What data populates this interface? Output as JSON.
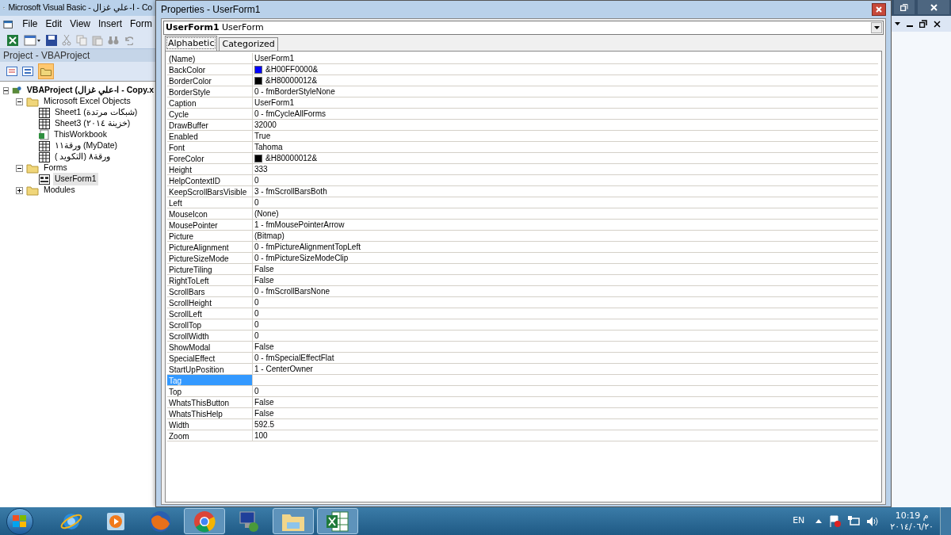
{
  "main_window": {
    "title": "Microsoft Visual Basic - ا-علي غزال - Co",
    "menu": [
      {
        "label": "File"
      },
      {
        "label": "Edit"
      },
      {
        "label": "View"
      },
      {
        "label": "Insert"
      },
      {
        "label": "Form"
      }
    ]
  },
  "project_pane": {
    "title": "Project - VBAProject",
    "tree": [
      {
        "label": "VBAProject (ا-علي غزال - Copy.x",
        "kind": "project",
        "expanded": true,
        "selected": false,
        "children": [
          {
            "label": "Microsoft Excel Objects",
            "kind": "folder",
            "expanded": true,
            "selected": false,
            "children": [
              {
                "label": "Sheet1 (شبكات مرتدة)",
                "kind": "sheet",
                "selected": false
              },
              {
                "label": "Sheet3 (خزينة ٢٠١٤)",
                "kind": "sheet",
                "selected": false
              },
              {
                "label": "ThisWorkbook",
                "kind": "workbook",
                "selected": false
              },
              {
                "label": "ورقة١١ (MyDate)",
                "kind": "sheet",
                "selected": false
              },
              {
                "label": "( ورقة٨ (التكويد",
                "kind": "sheet",
                "selected": false
              }
            ]
          },
          {
            "label": "Forms",
            "kind": "folder",
            "expanded": true,
            "selected": false,
            "children": [
              {
                "label": "UserForm1",
                "kind": "form",
                "selected": true
              }
            ]
          },
          {
            "label": "Modules",
            "kind": "folder",
            "expanded": false,
            "selected": false
          }
        ]
      }
    ]
  },
  "properties_window": {
    "title": "Properties - UserForm1",
    "object_name": "UserForm1",
    "object_type": "UserForm",
    "tabs": [
      {
        "label": "Alphabetic",
        "selected": true
      },
      {
        "label": "Categorized",
        "selected": false
      }
    ],
    "rows": [
      {
        "name": "(Name)",
        "value": "UserForm1",
        "selected": false
      },
      {
        "name": "BackColor",
        "value": "&H00FF0000&",
        "color": "#0000ff",
        "selected": false
      },
      {
        "name": "BorderColor",
        "value": "&H80000012&",
        "color": "#000000",
        "selected": false
      },
      {
        "name": "BorderStyle",
        "value": "0 - fmBorderStyleNone",
        "selected": false
      },
      {
        "name": "Caption",
        "value": "UserForm1",
        "selected": false
      },
      {
        "name": "Cycle",
        "value": "0 - fmCycleAllForms",
        "selected": false
      },
      {
        "name": "DrawBuffer",
        "value": "32000",
        "selected": false
      },
      {
        "name": "Enabled",
        "value": "True",
        "selected": false
      },
      {
        "name": "Font",
        "value": "Tahoma",
        "selected": false
      },
      {
        "name": "ForeColor",
        "value": "&H80000012&",
        "color": "#000000",
        "selected": false
      },
      {
        "name": "Height",
        "value": "333",
        "selected": false
      },
      {
        "name": "HelpContextID",
        "value": "0",
        "selected": false
      },
      {
        "name": "KeepScrollBarsVisible",
        "value": "3 - fmScrollBarsBoth",
        "selected": false
      },
      {
        "name": "Left",
        "value": "0",
        "selected": false
      },
      {
        "name": "MouseIcon",
        "value": "(None)",
        "selected": false
      },
      {
        "name": "MousePointer",
        "value": "1 - fmMousePointerArrow",
        "selected": false
      },
      {
        "name": "Picture",
        "value": "(Bitmap)",
        "selected": false
      },
      {
        "name": "PictureAlignment",
        "value": "0 - fmPictureAlignmentTopLeft",
        "selected": false
      },
      {
        "name": "PictureSizeMode",
        "value": "0 - fmPictureSizeModeClip",
        "selected": false
      },
      {
        "name": "PictureTiling",
        "value": "False",
        "selected": false
      },
      {
        "name": "RightToLeft",
        "value": "False",
        "selected": false
      },
      {
        "name": "ScrollBars",
        "value": "0 - fmScrollBarsNone",
        "selected": false
      },
      {
        "name": "ScrollHeight",
        "value": "0",
        "selected": false
      },
      {
        "name": "ScrollLeft",
        "value": "0",
        "selected": false
      },
      {
        "name": "ScrollTop",
        "value": "0",
        "selected": false
      },
      {
        "name": "ScrollWidth",
        "value": "0",
        "selected": false
      },
      {
        "name": "ShowModal",
        "value": "False",
        "selected": false
      },
      {
        "name": "SpecialEffect",
        "value": "0 - fmSpecialEffectFlat",
        "selected": false
      },
      {
        "name": "StartUpPosition",
        "value": "1 - CenterOwner",
        "selected": false
      },
      {
        "name": "Tag",
        "selected": true
      },
      {
        "name": "Top",
        "value": "0",
        "selected": false
      },
      {
        "name": "WhatsThisButton",
        "value": "False",
        "selected": false
      },
      {
        "name": "WhatsThisHelp",
        "value": "False",
        "selected": false
      },
      {
        "name": "Width",
        "value": "592.5",
        "selected": false
      },
      {
        "name": "Zoom",
        "value": "100",
        "selected": false
      }
    ]
  },
  "taskbar": {
    "apps": [
      {
        "kind": "ie",
        "running": false
      },
      {
        "kind": "player",
        "running": false
      },
      {
        "kind": "firefox",
        "running": false
      },
      {
        "kind": "chrome",
        "running": true
      },
      {
        "kind": "remote",
        "running": false
      },
      {
        "kind": "explorer",
        "running": true
      },
      {
        "kind": "excel",
        "running": true
      }
    ],
    "language": "EN",
    "time": "10:19 م",
    "date": "٢٠١٤/٠٦/٢٠"
  }
}
